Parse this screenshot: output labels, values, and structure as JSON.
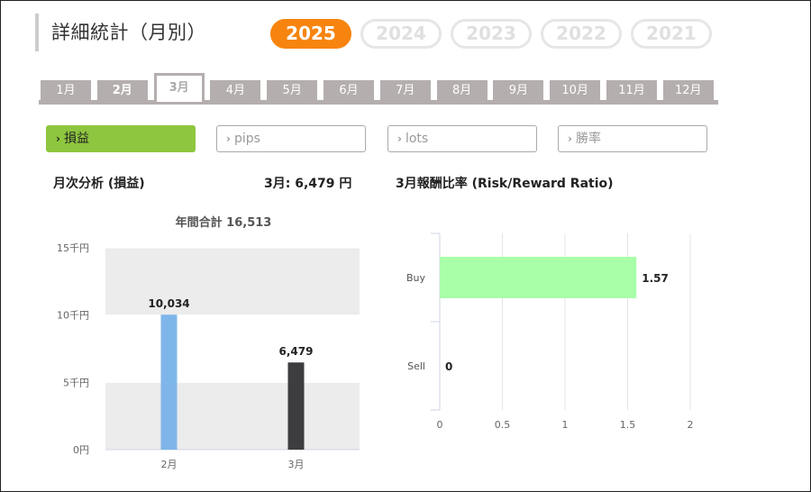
{
  "header": {
    "title": "詳細統計（月別）"
  },
  "years": [
    {
      "label": "2025",
      "active": true
    },
    {
      "label": "2024",
      "active": false
    },
    {
      "label": "2023",
      "active": false
    },
    {
      "label": "2022",
      "active": false
    },
    {
      "label": "2021",
      "active": false
    }
  ],
  "months": [
    {
      "label": "1月",
      "state": "normal"
    },
    {
      "label": "2月",
      "state": "visited"
    },
    {
      "label": "3月",
      "state": "active"
    },
    {
      "label": "4月",
      "state": "normal"
    },
    {
      "label": "5月",
      "state": "normal"
    },
    {
      "label": "6月",
      "state": "normal"
    },
    {
      "label": "7月",
      "state": "normal"
    },
    {
      "label": "8月",
      "state": "normal"
    },
    {
      "label": "9月",
      "state": "normal"
    },
    {
      "label": "10月",
      "state": "normal"
    },
    {
      "label": "11月",
      "state": "normal"
    },
    {
      "label": "12月",
      "state": "normal"
    }
  ],
  "metrics": [
    {
      "label": "損益",
      "active": true
    },
    {
      "label": "pips",
      "active": false
    },
    {
      "label": "lots",
      "active": false
    },
    {
      "label": "勝率",
      "active": false
    }
  ],
  "colors": {
    "accent": "#f7840e",
    "active_metric": "#8ec63f",
    "bar_feb": "#7fb6ea",
    "bar_mar": "#3d3d40",
    "buy_bar": "#a8ffa8"
  },
  "analysis": {
    "title": "月次分析 (損益)",
    "month_total": "3月:  6,479 円",
    "rr_title": "3月報酬比率 (Risk/Reward Ratio)"
  },
  "chart_data": [
    {
      "type": "bar",
      "title": "年間合計 16,513",
      "categories": [
        "2月",
        "3月"
      ],
      "values": [
        10034,
        6479
      ],
      "value_labels": [
        "10,034",
        "6,479"
      ],
      "yticks": [
        0,
        5000,
        10000,
        15000
      ],
      "ytick_labels": [
        "0円",
        "5千円",
        "10千円",
        "15千円"
      ],
      "ylim": [
        0,
        15000
      ],
      "colors": [
        "#7fb6ea",
        "#3d3d40"
      ]
    },
    {
      "type": "bar",
      "orientation": "horizontal",
      "categories": [
        "Buy",
        "Sell"
      ],
      "values": [
        1.57,
        0
      ],
      "value_labels": [
        "1.57",
        "0"
      ],
      "xticks": [
        0,
        0.5,
        1,
        1.5,
        2
      ],
      "xtick_labels": [
        "0",
        "0.5",
        "1",
        "1.5",
        "2"
      ],
      "xlim": [
        0,
        2
      ],
      "grid": true
    }
  ]
}
